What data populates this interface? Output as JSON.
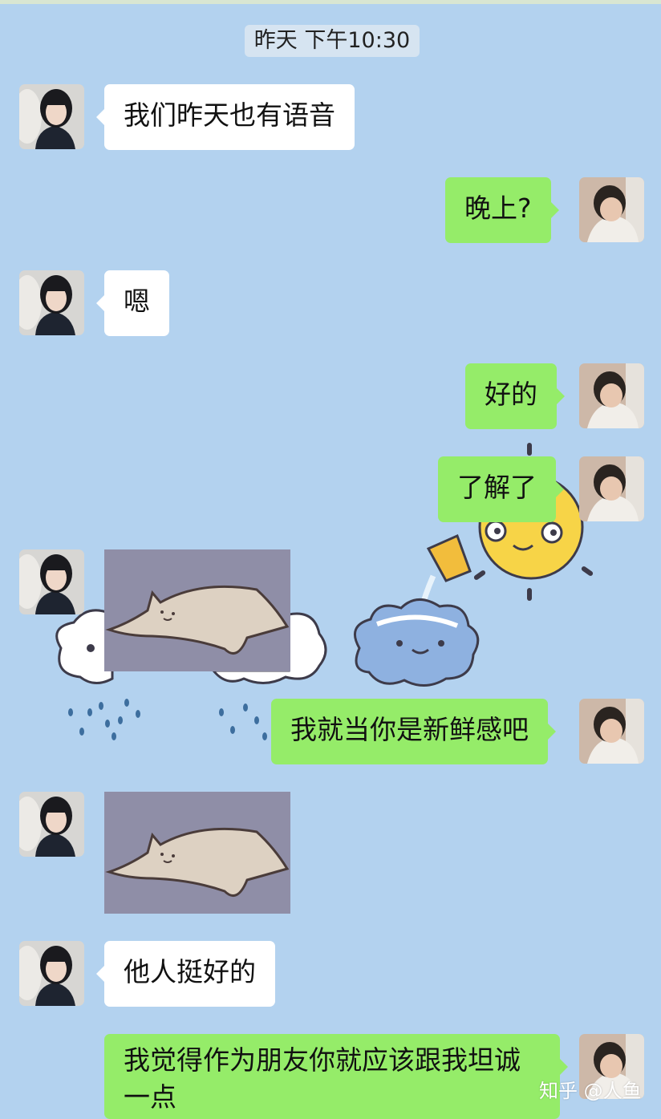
{
  "chat": {
    "timestamp": "昨天 下午10:30",
    "messages": [
      {
        "side": "left",
        "text": "我们昨天也有语音"
      },
      {
        "side": "right",
        "text": "晚上?"
      },
      {
        "side": "left",
        "text": "嗯"
      },
      {
        "side": "right",
        "text": "好的"
      },
      {
        "side": "right",
        "text": "了解了"
      },
      {
        "side": "left",
        "sticker": "cat-lying-sticker"
      },
      {
        "side": "right",
        "text": "我就当你是新鲜感吧"
      },
      {
        "side": "left",
        "sticker": "cat-lying-sticker"
      },
      {
        "side": "left",
        "text": "他人挺好的"
      },
      {
        "side": "right",
        "text": "我觉得作为朋友你就应该跟我坦诚一点"
      }
    ]
  },
  "watermark": "知乎 @人鱼",
  "colors": {
    "background": "#b3d2ef",
    "left_bubble": "#ffffff",
    "right_bubble": "#95ec69",
    "sticker_bg": "#8f8ea7"
  }
}
